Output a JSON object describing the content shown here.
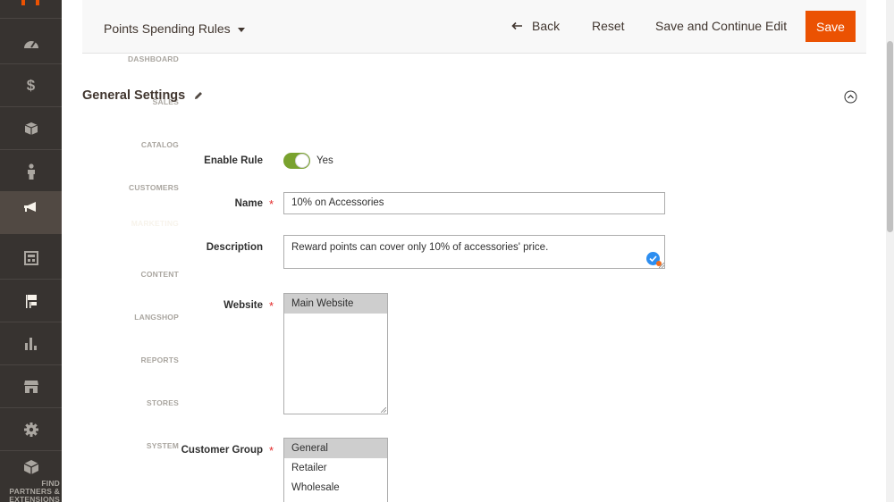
{
  "sidebar": {
    "items": [
      {
        "label": "DASHBOARD",
        "icon": "dashboard-icon"
      },
      {
        "label": "SALES",
        "icon": "dollar-icon"
      },
      {
        "label": "CATALOG",
        "icon": "box-icon"
      },
      {
        "label": "CUSTOMERS",
        "icon": "person-icon"
      },
      {
        "label": "MARKETING",
        "icon": "megaphone-icon"
      },
      {
        "label": "CONTENT",
        "icon": "layout-icon"
      },
      {
        "label": "LANGSHOP",
        "icon": "flags-icon"
      },
      {
        "label": "REPORTS",
        "icon": "bar-chart-icon"
      },
      {
        "label": "STORES",
        "icon": "storefront-icon"
      },
      {
        "label": "SYSTEM",
        "icon": "gear-icon"
      },
      {
        "label": "FIND PARTNERS & EXTENSIONS",
        "icon": "cube-icon"
      }
    ],
    "active": "MARKETING",
    "accent": "#514943"
  },
  "header": {
    "title": "Points Spending Rules",
    "back_label": "Back",
    "reset_label": "Reset",
    "save_continue_label": "Save and Continue Edit",
    "save_label": "Save",
    "save_color": "#eb5202"
  },
  "section": {
    "title": "General Settings"
  },
  "form": {
    "enable_rule": {
      "label": "Enable Rule",
      "value": "Yes",
      "on": true,
      "color": "#79a22e"
    },
    "name": {
      "label": "Name",
      "value": "10% on Accessories"
    },
    "description": {
      "label": "Description",
      "value": "Reward points can cover only 10% of accessories' price."
    },
    "website": {
      "label": "Website",
      "options": [
        "Main Website"
      ],
      "selected": "Main Website"
    },
    "customer_group": {
      "label": "Customer Group",
      "options": [
        "General",
        "Retailer",
        "Wholesale"
      ],
      "selected": "General"
    }
  }
}
